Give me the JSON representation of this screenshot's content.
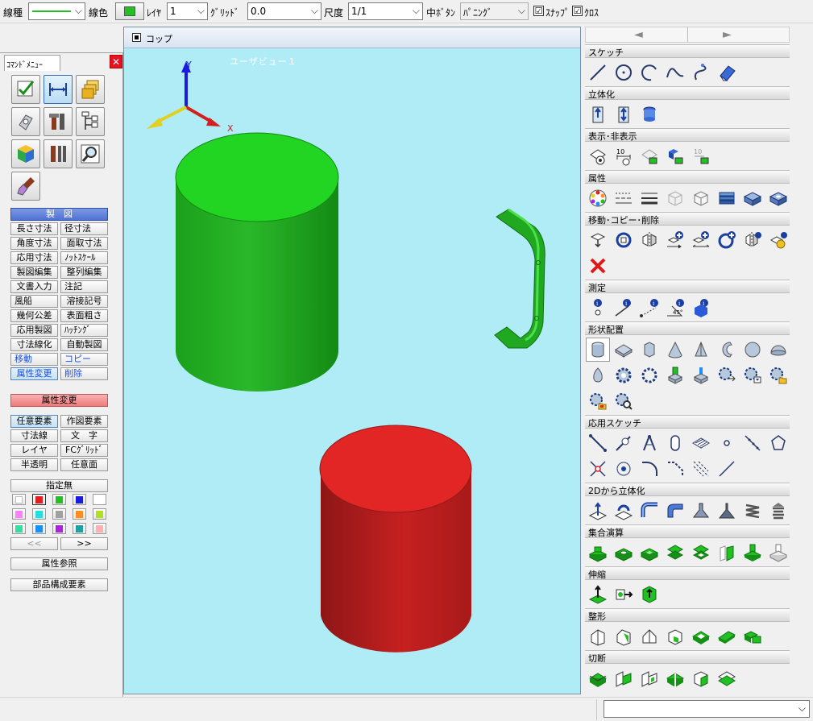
{
  "toolbar": {
    "line_type_label": "線種",
    "line_color_label": "線色",
    "line_color": "#22c022",
    "layer_label": "ﾚｲﾔ",
    "layer_value": "1",
    "grid_label": "ｸﾞﾘｯﾄﾞ",
    "grid_value": "0.0",
    "scale_label": "尺度",
    "scale_value": "1/1",
    "middle_button_label": "中ﾎﾞﾀﾝ",
    "middle_button_value": "ﾊﾟﾆﾝｸﾞ",
    "snap_label": "ｽﾅｯﾌﾟ",
    "snap_checked": "☑",
    "cross_label": "ｸﾛｽ",
    "cross_checked": "☑",
    "chevron": "⌵"
  },
  "left_panel": {
    "title": "ｺﾏﾝﾄﾞﾒﾆｭｰ",
    "close": "✕",
    "icons": [
      "sketch-check-icon",
      "dimension-icon",
      "layers-icon",
      "part-icon",
      "tools-icon",
      "tree-icon",
      "color-cube-icon",
      "hammer-pliers-icon",
      "search-measure-icon",
      "paint-brush-icon"
    ],
    "drafting_header": "製　図",
    "drafting_buttons": [
      "長さ寸法",
      "径寸法",
      "角度寸法",
      "面取寸法",
      "応用寸法",
      "ﾉｯﾄｽｹｰﾙ",
      "製図編集",
      "整列編集",
      "文書入力",
      "注記",
      "風船",
      "溶接記号",
      "幾何公差",
      "表面粗さ",
      "応用製図",
      "ﾊｯﾁﾝｸﾞ",
      "寸法線化",
      "自動製図",
      "移動",
      "コピー",
      "属性変更",
      "削除"
    ],
    "attr_header": "属性変更",
    "attr_buttons": [
      "任意要素",
      "作図要素",
      "寸法線",
      "文　字",
      "レイヤ",
      "FCｸﾞﾘｯﾄﾞ",
      "半透明",
      "任意面"
    ],
    "unspecified": "指定無",
    "swatches": [
      "#ffffff",
      "#e02020",
      "#22c022",
      "#1a1ae0",
      "#ff80ff",
      "#20e0e0",
      "#a0a0a0",
      "#ff9020",
      "#b0e020",
      "#30e0a0",
      "#1a90ff",
      "#b020e0",
      "#20a0a0",
      "#ffb0b0"
    ],
    "prev": "<<",
    "next": ">>",
    "attr_ref": "属性参照",
    "part_elements": "部品構成要素"
  },
  "viewport": {
    "title": "コップ",
    "view_label": "ユーザビュー１",
    "axis_x": "X",
    "axis_y": "Y",
    "green_color": "#22c022",
    "red_color": "#e02020"
  },
  "right_panel": {
    "nav_prev": "◄",
    "nav_next": "►",
    "sections": [
      "スケッチ",
      "立体化",
      "表示･非表示",
      "属性",
      "移動･コピー･削除",
      "測定",
      "形状配置",
      "応用スケッチ",
      "2Dから立体化",
      "集合演算",
      "伸縮",
      "整形",
      "切断"
    ]
  },
  "statusbar": {
    "combo_value": "",
    "chevron": "⌵"
  }
}
